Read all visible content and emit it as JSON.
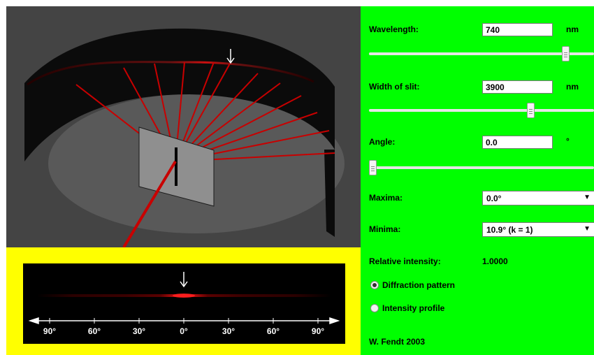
{
  "controls": {
    "wavelength": {
      "label": "Wavelength:",
      "value": "740",
      "unit": "nm",
      "slider_fraction": 0.886
    },
    "slit_width": {
      "label": "Width of slit:",
      "value": "3900",
      "unit": "nm",
      "slider_fraction": 0.728
    },
    "angle": {
      "label": "Angle:",
      "value": "0.0",
      "unit": "°",
      "slider_fraction": 0.0
    },
    "maxima": {
      "label": "Maxima:",
      "selected": "0.0°"
    },
    "minima": {
      "label": "Minima:",
      "selected": "10.9° (k = 1)"
    },
    "relative_intensity": {
      "label": "Relative intensity:",
      "value": "1.0000"
    },
    "view_modes": [
      {
        "label": "Diffraction pattern",
        "checked": true
      },
      {
        "label": "Intensity profile",
        "checked": false
      }
    ],
    "credit": "W. Fendt 2003"
  },
  "pattern": {
    "scale_labels": [
      "90°",
      "60°",
      "30°",
      "0°",
      "30°",
      "60°",
      "90°"
    ],
    "marker_angle_deg": 0
  },
  "colors": {
    "panel_bg": "#00ff00",
    "pattern_frame": "#ffff00",
    "sim_bg": "#444444",
    "ray": "#cc0000"
  },
  "icons": {
    "marker": "down-arrow-icon",
    "scale": "double-arrow-axis"
  }
}
